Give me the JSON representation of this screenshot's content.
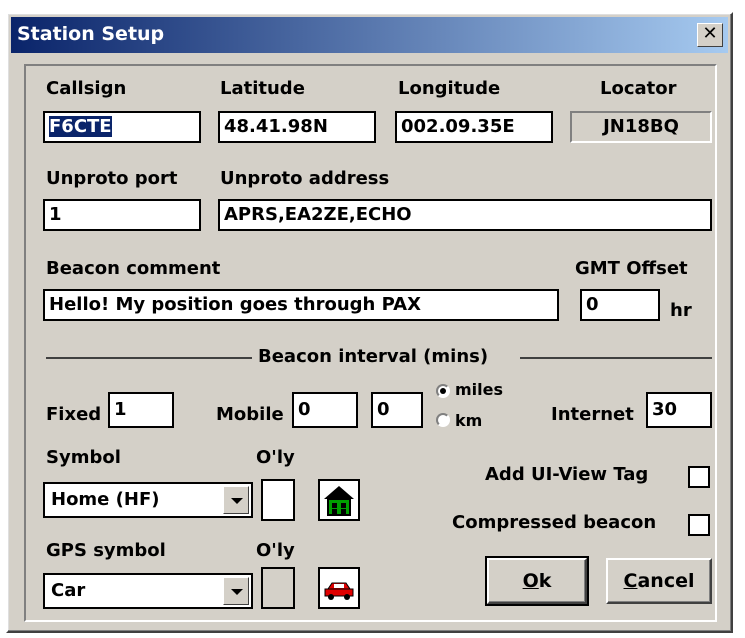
{
  "window": {
    "title": "Station Setup",
    "close_glyph": "✕"
  },
  "labels": {
    "callsign": "Callsign",
    "latitude": "Latitude",
    "longitude": "Longitude",
    "locator": "Locator",
    "unproto_port": "Unproto port",
    "unproto_address": "Unproto address",
    "beacon_comment": "Beacon comment",
    "gmt_offset": "GMT Offset",
    "hr": "hr",
    "beacon_interval": "Beacon interval (mins)",
    "fixed": "Fixed",
    "mobile": "Mobile",
    "miles": "miles",
    "km": "km",
    "internet": "Internet",
    "symbol": "Symbol",
    "overlay1": "O'ly",
    "gps_symbol": "GPS symbol",
    "overlay2": "O'ly",
    "add_ui_view_tag": "Add UI-View Tag",
    "compressed_beacon": "Compressed beacon"
  },
  "fields": {
    "callsign": "F6CTE",
    "latitude": "48.41.98N",
    "longitude": "002.09.35E",
    "locator": "JN18BQ",
    "unproto_port": "1",
    "unproto_address": "APRS,EA2ZE,ECHO",
    "beacon_comment": "Hello! My position goes through PAX",
    "gmt_offset": "0",
    "fixed": "1",
    "mobile_1": "0",
    "mobile_2": "0",
    "internet": "30"
  },
  "units_selected": "miles",
  "symbol": {
    "value": "Home (HF)",
    "icon": "house-icon"
  },
  "gps_symbol": {
    "value": "Car",
    "icon": "car-icon"
  },
  "checkboxes": {
    "add_ui_view_tag": false,
    "compressed_beacon": false
  },
  "buttons": {
    "ok": "Ok",
    "ok_accel": "O",
    "ok_rest": "k",
    "cancel": "Cancel",
    "cancel_accel": "C",
    "cancel_rest": "ancel"
  },
  "colors": {
    "title_bar_start": "#0a246a",
    "title_bar_end": "#a6caf0",
    "dialog_bg": "#d4d0c8",
    "house_green": "#00a000",
    "car_red": "#e00000"
  }
}
